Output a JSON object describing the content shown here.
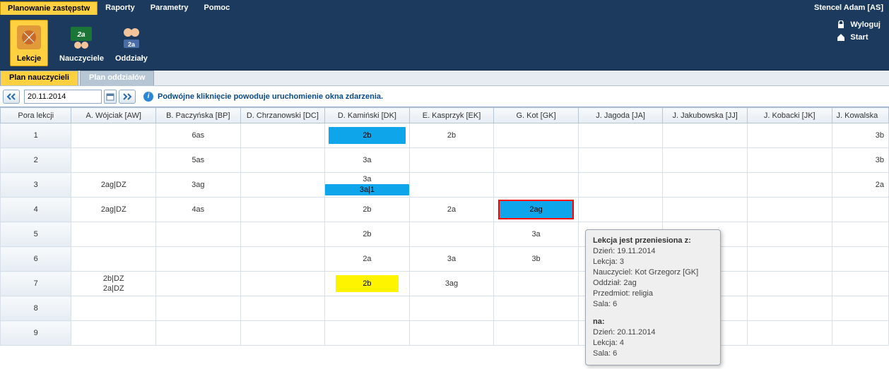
{
  "menu": {
    "tabs": [
      "Planowanie zastępstw",
      "Raporty",
      "Parametry",
      "Pomoc"
    ],
    "user": "Stencel Adam [AS]"
  },
  "ribbon": {
    "items": [
      {
        "label": "Lekcje"
      },
      {
        "label": "Nauczyciele"
      },
      {
        "label": "Oddziały"
      }
    ],
    "right_links": [
      {
        "label": "Wyloguj"
      },
      {
        "label": "Start"
      }
    ]
  },
  "sub_tabs": {
    "active": "Plan nauczycieli",
    "inactive": "Plan oddziałów"
  },
  "toolbar": {
    "date": "20.11.2014",
    "info": "Podwójne kliknięcie powoduje uruchomienie okna zdarzenia."
  },
  "grid": {
    "row_header": "Pora lekcji",
    "columns": [
      "A. Wójciak [AW]",
      "B. Paczyńska [BP]",
      "D. Chrzanowski [DC]",
      "D. Kamiński [DK]",
      "E. Kasprzyk [EK]",
      "G. Kot [GK]",
      "J. Jagoda [JA]",
      "J. Jakubowska [JJ]",
      "J. Kobacki [JK]",
      "J. Kowalska"
    ],
    "periods": [
      "1",
      "2",
      "3",
      "4",
      "5",
      "6",
      "7",
      "8",
      "9"
    ],
    "cells": {
      "r1": {
        "c2": "6as",
        "c4_blue": "2b",
        "c5": "2b",
        "c10": "3b"
      },
      "r2": {
        "c2": "5as",
        "c4": "3a",
        "c10": "3b"
      },
      "r3": {
        "c1": "2ag|DZ",
        "c2": "3ag",
        "c4_top": "3a",
        "c4_bottom_blue": "3a|1",
        "c10": "2a"
      },
      "r4": {
        "c1": "2ag|DZ",
        "c2": "4as",
        "c4": "2b",
        "c5": "2a",
        "c6_selected": "2ag"
      },
      "r5": {
        "c4": "2b",
        "c6": "3a"
      },
      "r6": {
        "c4": "2a",
        "c5": "3a",
        "c6": "3b"
      },
      "r7": {
        "c1_line1": "2b|DZ",
        "c1_line2": "2a|DZ",
        "c4_yellow": "2b",
        "c5": "3ag"
      }
    }
  },
  "tooltip": {
    "title": "Lekcja jest przeniesiona z:",
    "from_day_label": "Dzień:",
    "from_day": "19.11.2014",
    "from_lesson_label": "Lekcja:",
    "from_lesson": "3",
    "teacher_label": "Nauczyciel:",
    "teacher": "Kot Grzegorz [GK]",
    "class_label": "Oddział:",
    "class": "2ag",
    "subject_label": "Przedmiot:",
    "subject": "religia",
    "room_label": "Sala:",
    "room": "6",
    "to_title": "na:",
    "to_day_label": "Dzień:",
    "to_day": "20.11.2014",
    "to_lesson_label": "Lekcja:",
    "to_lesson": "4",
    "to_room_label": "Sala:",
    "to_room": "6"
  }
}
